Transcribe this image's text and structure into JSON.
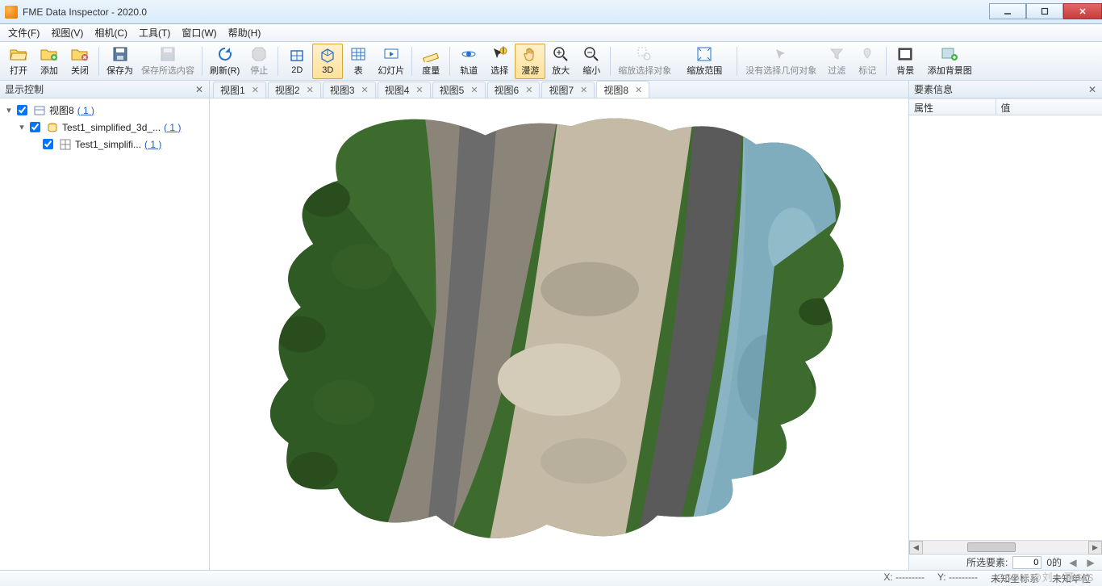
{
  "window": {
    "title": "FME Data Inspector - 2020.0"
  },
  "menu": {
    "file": "文件(F)",
    "view": "视图(V)",
    "camera": "相机(C)",
    "tools": "工具(T)",
    "window": "窗口(W)",
    "help": "帮助(H)"
  },
  "toolbar": {
    "open": "打开",
    "add": "添加",
    "close": "关闭",
    "saveas": "保存为",
    "saveSelected": "保存所选内容",
    "refresh": "刷新(R)",
    "stop": "停止",
    "mode2d": "2D",
    "mode3d": "3D",
    "table": "表",
    "slideshow": "幻灯片",
    "measure": "度量",
    "orbit": "轨道",
    "select": "选择",
    "pan": "漫游",
    "zoomin": "放大",
    "zoomout": "缩小",
    "zoomsel": "缩放选择对象",
    "zoomext": "缩放范围",
    "nosel": "没有选择几何对象",
    "filter": "过滤",
    "mark": "标记",
    "bg": "背景",
    "addbg": "添加背景图"
  },
  "panels": {
    "displayControl": "显示控制",
    "featureInfo": "要素信息",
    "propAttr": "属性",
    "propVal": "值"
  },
  "tree": {
    "root": {
      "label": "视图8",
      "count": "1"
    },
    "child1": {
      "label": "Test1_simplified_3d_...",
      "count": "1"
    },
    "child2": {
      "label": "Test1_simplifi...",
      "count": "1"
    }
  },
  "tabs": [
    {
      "label": "视图1"
    },
    {
      "label": "视图2"
    },
    {
      "label": "视图3"
    },
    {
      "label": "视图4"
    },
    {
      "label": "视图5"
    },
    {
      "label": "视图6"
    },
    {
      "label": "视图7"
    },
    {
      "label": "视图8"
    }
  ],
  "activeTabIndex": 7,
  "selstatus": {
    "label": "所选要素:",
    "value": "0",
    "of": "0的"
  },
  "status": {
    "x": "X:",
    "xv": "---------",
    "y": "Y:",
    "yv": "---------",
    "coord": "未知坐标系",
    "unit": "未知单位"
  },
  "watermark": "CSDN @刘一哥GIS"
}
